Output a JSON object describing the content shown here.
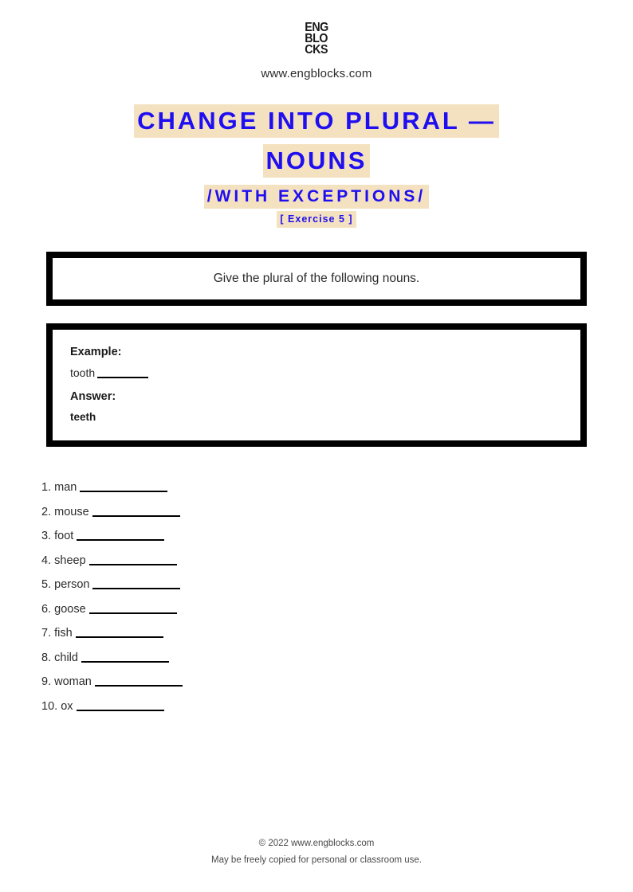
{
  "header": {
    "logo_lines": [
      "ENG",
      "BLO",
      "CKS"
    ],
    "site_url": "www.engblocks.com"
  },
  "title": {
    "line1": "CHANGE INTO PLURAL —",
    "line2": "NOUNS",
    "subtitle": "/WITH EXCEPTIONS/",
    "exercise": "[ Exercise 5 ]",
    "text_color": "#1f0ff0",
    "highlight_color": "#f4e1c0"
  },
  "instruction": {
    "text": "Give the plural of the following nouns."
  },
  "example": {
    "example_label": "Example:",
    "prompt_word": "tooth",
    "answer_label": "Answer:",
    "answer_word": "teeth"
  },
  "questions": [
    {
      "number": "1.",
      "word": "man"
    },
    {
      "number": "2.",
      "word": "mouse"
    },
    {
      "number": "3.",
      "word": "foot"
    },
    {
      "number": "4.",
      "word": "sheep"
    },
    {
      "number": "5.",
      "word": "person"
    },
    {
      "number": "6.",
      "word": "goose"
    },
    {
      "number": "7.",
      "word": "fish"
    },
    {
      "number": "8.",
      "word": "child"
    },
    {
      "number": "9.",
      "word": "woman"
    },
    {
      "number": "10.",
      "word": "ox"
    }
  ],
  "footer": {
    "copyright": "© 2022 www.engblocks.com",
    "note": "May be freely copied for personal or classroom use."
  }
}
